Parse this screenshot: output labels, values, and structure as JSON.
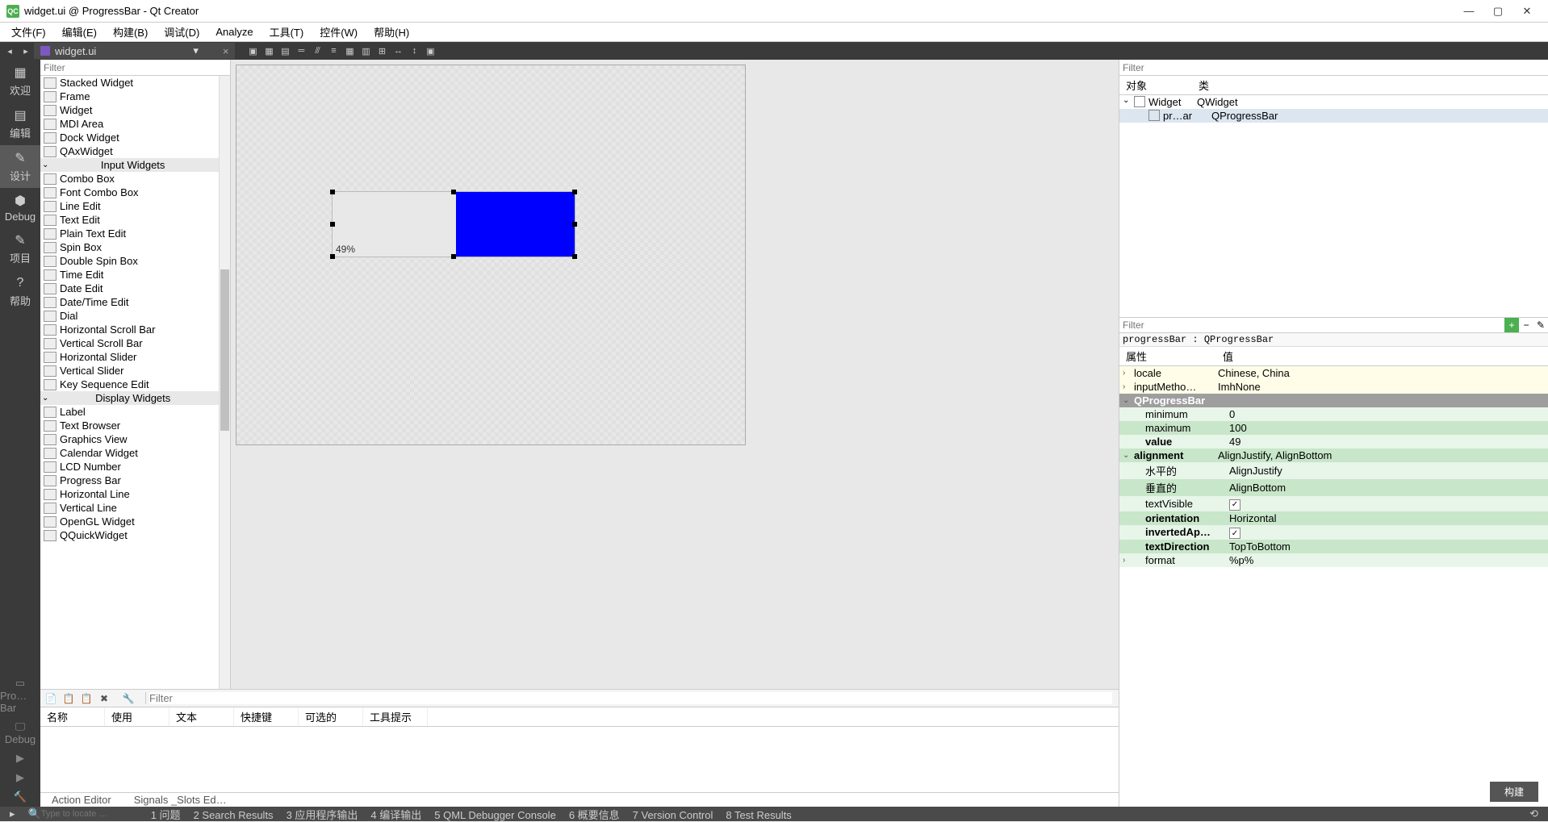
{
  "window": {
    "app_icon": "QC",
    "title": "widget.ui @ ProgressBar - Qt Creator"
  },
  "menubar": [
    "文件(F)",
    "编辑(E)",
    "构建(B)",
    "调试(D)",
    "Analyze",
    "工具(T)",
    "控件(W)",
    "帮助(H)"
  ],
  "tab": {
    "name": "widget.ui"
  },
  "leftbar": [
    {
      "label": "欢迎",
      "icon": "▦"
    },
    {
      "label": "编辑",
      "icon": "▤"
    },
    {
      "label": "设计",
      "icon": "✎",
      "active": true
    },
    {
      "label": "Debug",
      "icon": "⬢"
    },
    {
      "label": "项目",
      "icon": "✎"
    },
    {
      "label": "帮助",
      "icon": "?"
    }
  ],
  "leftbar_bottom": [
    {
      "label": "Pro…Bar",
      "icon": "▭"
    },
    {
      "label": "Debug",
      "icon": "🖵"
    },
    {
      "label": "",
      "icon": "▶"
    },
    {
      "label": "",
      "icon": "▶"
    },
    {
      "label": "",
      "icon": "🔨"
    }
  ],
  "widgetbox": {
    "filter_ph": "Filter",
    "items_top": [
      "Stacked Widget",
      "Frame",
      "Widget",
      "MDI Area",
      "Dock Widget",
      "QAxWidget"
    ],
    "cat_input": "Input Widgets",
    "items_input": [
      "Combo Box",
      "Font Combo Box",
      "Line Edit",
      "Text Edit",
      "Plain Text Edit",
      "Spin Box",
      "Double Spin Box",
      "Time Edit",
      "Date Edit",
      "Date/Time Edit",
      "Dial",
      "Horizontal Scroll Bar",
      "Vertical Scroll Bar",
      "Horizontal Slider",
      "Vertical Slider",
      "Key Sequence Edit"
    ],
    "cat_display": "Display Widgets",
    "items_display": [
      "Label",
      "Text Browser",
      "Graphics View",
      "Calendar Widget",
      "LCD Number",
      "Progress Bar",
      "Horizontal Line",
      "Vertical Line",
      "OpenGL Widget",
      "QQuickWidget"
    ]
  },
  "form": {
    "progress_text": "49%"
  },
  "actions": {
    "filter_ph": "Filter",
    "headers": [
      "名称",
      "使用",
      "文本",
      "快捷键",
      "可选的",
      "工具提示"
    ],
    "tabs": [
      "Action Editor",
      "Signals _Slots Ed…"
    ]
  },
  "object_tree": {
    "filter_ph": "Filter",
    "headers": [
      "对象",
      "类"
    ],
    "rows": [
      {
        "name": "Widget",
        "cls": "QWidget",
        "expanded": true
      },
      {
        "name": "pr…ar",
        "cls": "QProgressBar",
        "selected": true
      }
    ]
  },
  "props": {
    "filter_ph": "Filter",
    "obj": "progressBar : QProgressBar",
    "headers": [
      "属性",
      "值"
    ],
    "rows": [
      {
        "k": "locale",
        "v": "Chinese, China",
        "cls": "yellow",
        "chev": "›"
      },
      {
        "k": "inputMetho…",
        "v": "ImhNone",
        "cls": "yellow",
        "chev": "›"
      },
      {
        "k": "QProgressBar",
        "v": "",
        "cls": "gray",
        "chev": "⌄",
        "bold": true
      },
      {
        "k": "minimum",
        "v": "0",
        "cls": "green1",
        "indent": true
      },
      {
        "k": "maximum",
        "v": "100",
        "cls": "green2",
        "indent": true
      },
      {
        "k": "value",
        "v": "49",
        "cls": "green1",
        "indent": true,
        "bold": true
      },
      {
        "k": "alignment",
        "v": "AlignJustify, AlignBottom",
        "cls": "green2",
        "chev": "⌄",
        "bold": true
      },
      {
        "k": "水平的",
        "v": "AlignJustify",
        "cls": "green1",
        "indent": true
      },
      {
        "k": "垂直的",
        "v": "AlignBottom",
        "cls": "green2",
        "indent": true
      },
      {
        "k": "textVisible",
        "v": "",
        "cls": "green1",
        "cb": true,
        "indent": true
      },
      {
        "k": "orientation",
        "v": "Horizontal",
        "cls": "green2",
        "indent": true,
        "bold": true
      },
      {
        "k": "invertedAp…",
        "v": "",
        "cls": "green1",
        "cb": true,
        "indent": true,
        "bold": true
      },
      {
        "k": "textDirection",
        "v": "TopToBottom",
        "cls": "green2",
        "indent": true,
        "bold": true
      },
      {
        "k": "format",
        "v": "%p%",
        "cls": "green1",
        "chev": "›",
        "indent": true
      }
    ]
  },
  "build_btn": "构建",
  "statusbar": {
    "search_ph": "Type to locate …",
    "items": [
      "1 问题",
      "2 Search Results",
      "3 应用程序输出",
      "4 编译输出",
      "5 QML Debugger Console",
      "6 概要信息",
      "7 Version Control",
      "8 Test Results"
    ]
  }
}
